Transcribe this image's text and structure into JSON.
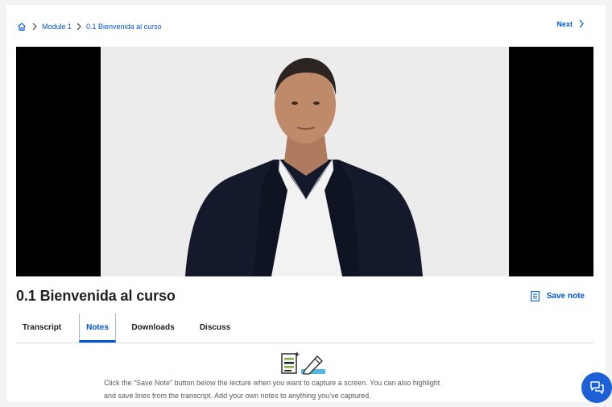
{
  "breadcrumb": {
    "home_icon": "home-icon",
    "items": [
      "Module 1",
      "0.1 Bienvenida al curso"
    ]
  },
  "nav": {
    "next_label": "Next"
  },
  "video": {
    "description_icon": "lecture-video"
  },
  "lecture": {
    "title": "0.1 Bienvenida al curso",
    "save_note_label": "Save note"
  },
  "tabs": [
    {
      "label": "Transcript",
      "active": false
    },
    {
      "label": "Notes",
      "active": true
    },
    {
      "label": "Downloads",
      "active": false
    },
    {
      "label": "Discuss",
      "active": false
    }
  ],
  "notes_panel": {
    "help_line_1": "Click the “Save Note” button below the lecture when you want to capture a screen. You can also highlight",
    "help_line_2": "and save lines from the transcript. Add your own notes to anything you’ve captured."
  },
  "colors": {
    "accent": "#0056d2",
    "fab": "#1c5fd6"
  }
}
